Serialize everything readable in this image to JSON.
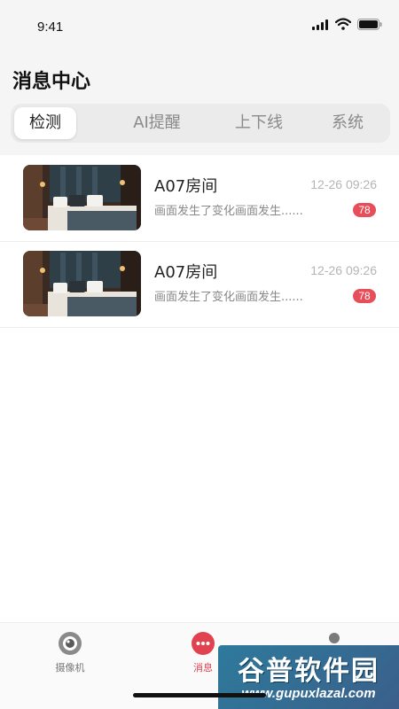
{
  "status_bar": {
    "time": "9:41"
  },
  "header": {
    "title": "消息中心"
  },
  "tabs": [
    {
      "label": "检测",
      "active": true
    },
    {
      "label": "AI提醒",
      "active": false
    },
    {
      "label": "上下线",
      "active": false
    },
    {
      "label": "系统",
      "active": false
    }
  ],
  "messages": [
    {
      "title": "A07房间",
      "time": "12-26 09:26",
      "preview": "画面发生了变化画面发生......",
      "badge": "78"
    },
    {
      "title": "A07房间",
      "time": "12-26 09:26",
      "preview": "画面发生了变化画面发生......",
      "badge": "78"
    }
  ],
  "tabbar": {
    "items": [
      {
        "label": "摄像机",
        "icon": "camera-icon",
        "active": false
      },
      {
        "label": "消息",
        "icon": "message-icon",
        "active": true
      },
      {
        "label": "",
        "icon": "person-icon",
        "active": false
      }
    ]
  },
  "watermark": {
    "top": "谷普软件园",
    "bottom": "www.gupuxlazal.com"
  },
  "colors": {
    "accent": "#e0434f",
    "badge": "#e84d5a",
    "background": "#f5f5f5"
  }
}
